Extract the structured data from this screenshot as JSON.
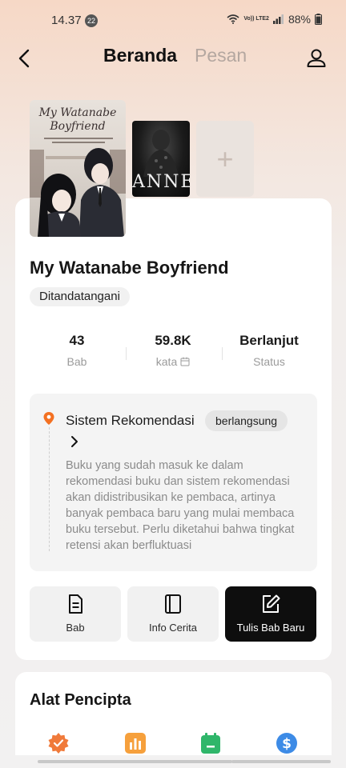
{
  "status_bar": {
    "time": "14.37",
    "notification_count": "22",
    "network_label": "Vo)) LTE2",
    "battery": "88%"
  },
  "header": {
    "tabs": [
      {
        "label": "Beranda",
        "active": true
      },
      {
        "label": "Pesan",
        "active": false
      }
    ]
  },
  "covers": {
    "main_cover_title": "My Watanabe Boyfriend",
    "second_cover_title": "ANNE",
    "add_cover_symbol": "+"
  },
  "book": {
    "title": "My Watanabe Boyfriend",
    "signed_badge": "Ditandatangani",
    "stats": [
      {
        "value": "43",
        "label": "Bab"
      },
      {
        "value": "59.8K",
        "label": "kata"
      },
      {
        "value": "Berlanjut",
        "label": "Status"
      }
    ]
  },
  "recommendation": {
    "title": "Sistem Rekomendasi",
    "status": "berlangsung",
    "description": "Buku yang sudah masuk ke dalam rekomendasi buku dan sistem rekomendasi akan didistribusikan ke pembaca, artinya banyak pembaca baru yang mulai membaca buku tersebut. Perlu diketahui bahwa tingkat retensi akan berfluktuasi"
  },
  "actions": [
    {
      "label": "Bab",
      "icon": "document-icon"
    },
    {
      "label": "Info Cerita",
      "icon": "book-icon"
    },
    {
      "label": "Tulis Bab Baru",
      "icon": "edit-icon"
    }
  ],
  "creator_tools": {
    "title": "Alat Pencipta",
    "icons": [
      "badge-icon",
      "bar-chart-icon",
      "calendar-icon",
      "dollar-icon"
    ]
  },
  "colors": {
    "accent_orange": "#f37021",
    "primary_button": "#0e0e0e",
    "tool_orange_badge": "#f07a3a",
    "tool_orange_chart": "#f6a03c",
    "tool_green_calendar": "#2fb66a",
    "tool_blue_dollar": "#3d8be6"
  }
}
